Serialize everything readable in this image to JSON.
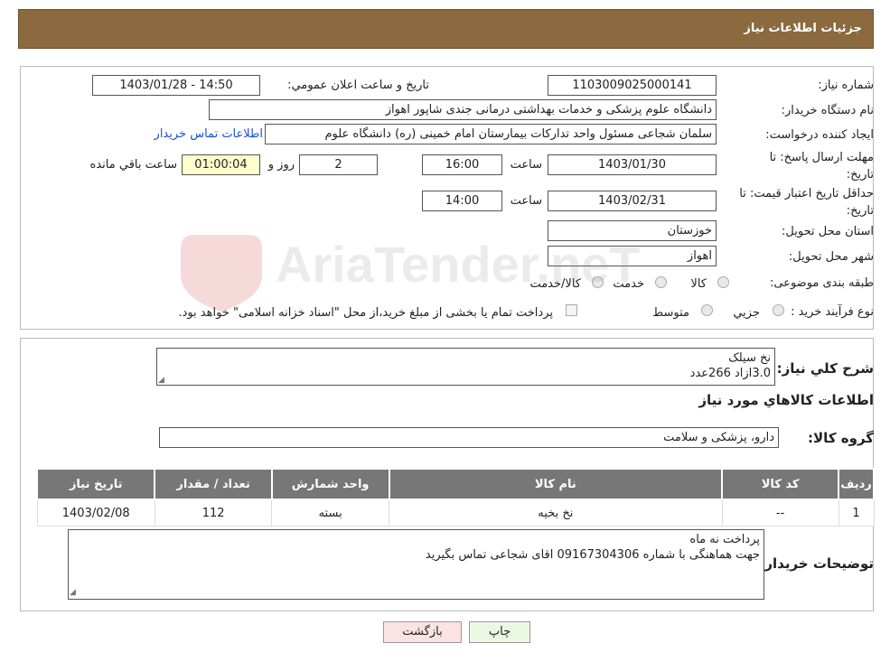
{
  "header": {
    "title": "جزئیات اطلاعات نیاز"
  },
  "form": {
    "need_number": {
      "label": "شماره نیاز:",
      "value": "1103009025000141"
    },
    "announce": {
      "label": "تاریخ و ساعت اعلان عمومي:",
      "value": "1403/01/28 - 14:50"
    },
    "buyer_org": {
      "label": "نام دستگاه خريدار:",
      "value": "دانشگاه علوم پزشکی و خدمات بهداشتی درمانی جندی شاپور اهواز"
    },
    "requester": {
      "label": "ايجاد کننده درخواست:",
      "value": "سلمان شجاعی مسئول واحد تداركات بیمارستان امام خمینی (ره) دانشگاه علوم",
      "contact_link": "اطلاعات تماس خريدار"
    },
    "deadline": {
      "label_line1": "مهلت ارسال پاسخ: تا",
      "label_line2": "تاريخ:",
      "date": "1403/01/30",
      "time_label": "ساعت",
      "time": "16:00",
      "days": "2",
      "days_label": "روز و",
      "remaining": "01:00:04",
      "remaining_label": "ساعت باقي مانده"
    },
    "validity": {
      "label_line1": "حداقل تاريخ اعتبار قيمت: تا",
      "label_line2": "تاريخ:",
      "date": "1403/02/31",
      "time_label": "ساعت",
      "time": "14:00"
    },
    "province": {
      "label": "استان محل تحويل:",
      "value": "خوزستان"
    },
    "city": {
      "label": "شهر محل تحويل:",
      "value": "اهواز"
    },
    "category": {
      "label": "طبقه بندی موضوعی:",
      "options": [
        "كالا",
        "خدمت",
        "كالا/خدمت"
      ]
    },
    "process": {
      "label": "نوع فرآيند خريد :",
      "options": [
        "جزيي",
        "متوسط"
      ],
      "note": "پرداخت تمام يا بخشی از مبلغ خريد،از محل \"اسناد خزانه اسلامی\" خواهد بود."
    }
  },
  "details": {
    "general_desc_label": "شرح كلي نياز:",
    "general_desc": "نخ سیلک\n3.0ازاد 266عدد",
    "items_title": "اطلاعات كالاهاي مورد نياز",
    "group_label": "گروه كالا:",
    "group_value": "دارو، پزشکی و سلامت",
    "table": {
      "headers": [
        "رديف",
        "كد كالا",
        "نام كالا",
        "واحد شمارش",
        "تعداد / مقدار",
        "تاريخ نياز"
      ],
      "rows": [
        [
          "1",
          "--",
          "نخ بخیه",
          "بسته",
          "112",
          "1403/02/08"
        ]
      ]
    },
    "buyer_notes_label": "توضيحات خريدار:",
    "buyer_notes": "پرداخت نه ماه\nجهت هماهنگی با شماره 09167304306 اقای شجاعی تماس بگیرید"
  },
  "buttons": {
    "print": "چاپ",
    "back": "بازگشت"
  },
  "watermark": {
    "text": "AriaTender.neT"
  },
  "colors": {
    "header_bg": "#8a6a3e",
    "table_header_bg": "#777777",
    "link": "#1a4fd6"
  }
}
